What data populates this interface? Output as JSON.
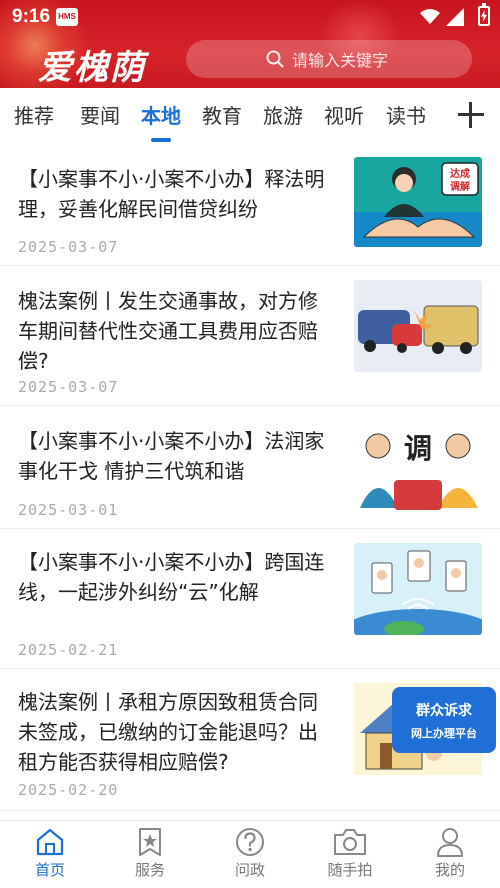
{
  "status_bar": {
    "time": "9:16",
    "badge": "HMS"
  },
  "header": {
    "logo": "爱槐荫",
    "search_placeholder": "请输入关键字"
  },
  "tabs": [
    {
      "label": "推荐",
      "active": false
    },
    {
      "label": "要闻",
      "active": false
    },
    {
      "label": "本地",
      "active": true
    },
    {
      "label": "教育",
      "active": false
    },
    {
      "label": "旅游",
      "active": false
    },
    {
      "label": "视听",
      "active": false
    },
    {
      "label": "读书",
      "active": false
    }
  ],
  "news": [
    {
      "title": "【小案事不小·小案不小办】释法明理，妥善化解民间借贷纠纷",
      "date": "2025-03-07",
      "thumb_text": [
        "达成",
        "调解"
      ]
    },
    {
      "title": "槐法案例丨发生交通事故，对方修车期间替代性交通工具费用应否赔偿?",
      "date": "2025-03-07"
    },
    {
      "title": "【小案事不小·小案不小办】法润家事化干戈  情护三代筑和谐",
      "date": "2025-03-01"
    },
    {
      "title": "【小案事不小·小案不小办】跨国连线，一起涉外纠纷“云”化解",
      "date": "2025-02-21"
    },
    {
      "title": "槐法案例丨承租方原因致租赁合同未签成，已缴纳的订金能退吗？出租方能否获得相应赔偿?",
      "date": "2025-02-20",
      "thumb_text": [
        "群众诉求",
        "网上办理平台"
      ]
    }
  ],
  "bottom_nav": [
    {
      "label": "首页",
      "icon": "home-icon",
      "active": true
    },
    {
      "label": "服务",
      "icon": "star-bookmark-icon",
      "active": false
    },
    {
      "label": "问政",
      "icon": "question-icon",
      "active": false
    },
    {
      "label": "随手拍",
      "icon": "camera-icon",
      "active": false
    },
    {
      "label": "我的",
      "icon": "user-icon",
      "active": false
    }
  ],
  "colors": {
    "brand_red": "#c8141e",
    "accent_blue": "#1a6fd6"
  }
}
